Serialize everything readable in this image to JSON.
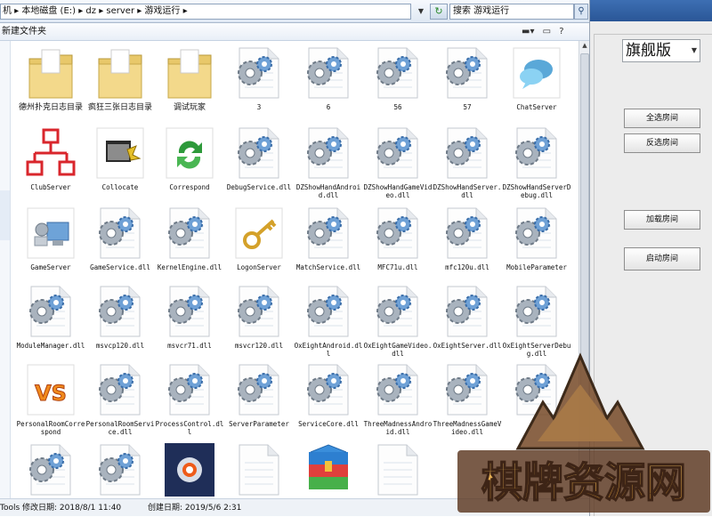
{
  "address": {
    "path": "机 ▸ 本地磁盘 (E:) ▸ dz ▸ server ▸ 游戏运行 ▸",
    "search_placeholder": "搜索 游戏运行"
  },
  "toolbar": {
    "new_folder": "新建文件夹"
  },
  "files": [
    {
      "label": "德州扑克日志目录",
      "icon": "folder-icon",
      "cn": true
    },
    {
      "label": "疯狂三张日志目录",
      "icon": "folder-icon",
      "cn": true
    },
    {
      "label": "调试玩家",
      "icon": "folder-icon",
      "cn": true
    },
    {
      "label": "3",
      "icon": "gear-file-icon"
    },
    {
      "label": "6",
      "icon": "gear-file-icon"
    },
    {
      "label": "56",
      "icon": "gear-file-icon"
    },
    {
      "label": "57",
      "icon": "gear-file-icon"
    },
    {
      "label": "ChatServer",
      "icon": "chat-bubble-icon"
    },
    {
      "label": "ClubServer",
      "icon": "org-chart-icon"
    },
    {
      "label": "Collocate",
      "icon": "app-window-icon"
    },
    {
      "label": "Correspond",
      "icon": "refresh-arrows-icon"
    },
    {
      "label": "DebugService.dll",
      "icon": "gear-file-icon"
    },
    {
      "label": "DZShowHandAndroid.dll",
      "icon": "gear-file-icon"
    },
    {
      "label": "DZShowHandGameVideo.dll",
      "icon": "gear-file-icon"
    },
    {
      "label": "DZShowHandServer.dll",
      "icon": "gear-file-icon"
    },
    {
      "label": "DZShowHandServerDebug.dll",
      "icon": "gear-file-icon"
    },
    {
      "label": "GameServer",
      "icon": "computer-icon"
    },
    {
      "label": "GameService.dll",
      "icon": "gear-file-icon"
    },
    {
      "label": "KernelEngine.dll",
      "icon": "gear-file-icon"
    },
    {
      "label": "LogonServer",
      "icon": "key-icon"
    },
    {
      "label": "MatchService.dll",
      "icon": "gear-file-icon"
    },
    {
      "label": "MFC71u.dll",
      "icon": "gear-file-icon"
    },
    {
      "label": "mfc120u.dll",
      "icon": "gear-file-icon"
    },
    {
      "label": "MobileParameter",
      "icon": "gear-file-icon"
    },
    {
      "label": "ModuleManager.dll",
      "icon": "gear-file-icon"
    },
    {
      "label": "msvcp120.dll",
      "icon": "gear-file-icon"
    },
    {
      "label": "msvcr71.dll",
      "icon": "gear-file-icon"
    },
    {
      "label": "msvcr120.dll",
      "icon": "gear-file-icon"
    },
    {
      "label": "OxEightAndroid.dll",
      "icon": "gear-file-icon"
    },
    {
      "label": "OxEightGameVideo.dll",
      "icon": "gear-file-icon"
    },
    {
      "label": "OxEightServer.dll",
      "icon": "gear-file-icon"
    },
    {
      "label": "OxEightServerDebug.dll",
      "icon": "gear-file-icon"
    },
    {
      "label": "PersonalRoomCorrespond",
      "icon": "vs-logo-icon"
    },
    {
      "label": "PersonalRoomService.dll",
      "icon": "gear-file-icon"
    },
    {
      "label": "ProcessControl.dll",
      "icon": "gear-file-icon"
    },
    {
      "label": "ServerParameter",
      "icon": "gear-file-icon"
    },
    {
      "label": "ServiceCore.dll",
      "icon": "gear-file-icon"
    },
    {
      "label": "ThreeMadnessAndroid.dll",
      "icon": "gear-file-icon"
    },
    {
      "label": "ThreeMadnessGameVideo.dll",
      "icon": "gear-file-icon"
    },
    {
      "label": "",
      "icon": "gear-file-icon"
    },
    {
      "label": "",
      "icon": "gear-file-icon"
    },
    {
      "label": "",
      "icon": "gear-file-icon"
    },
    {
      "label": "",
      "icon": "dark-app-icon"
    },
    {
      "label": "",
      "icon": "blank-file-icon"
    },
    {
      "label": "",
      "icon": "winrar-icon"
    },
    {
      "label": "",
      "icon": "blank-file-icon"
    }
  ],
  "status": {
    "modified": "Tools  修改日期: 2018/8/1 11:40",
    "created": "创建日期: 2019/5/6 2:31"
  },
  "app": {
    "edition": "旗舰版",
    "buttons": [
      "全选房间",
      "反选房间",
      "加载房间",
      "启动房间"
    ]
  },
  "watermark": {
    "text": "棋牌资源网"
  }
}
